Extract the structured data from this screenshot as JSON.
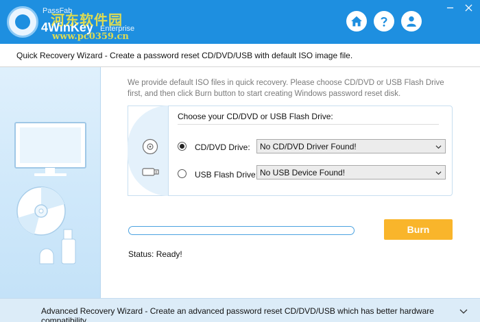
{
  "app": {
    "brand": "PassFab",
    "product": "4WinKey",
    "edition": "Enterprise",
    "watermark": "河东软件园",
    "watermark_url": "www.pc0359.cn"
  },
  "titlebar": {
    "home_icon": "home-icon",
    "help_icon": "help-icon",
    "account_icon": "user-icon",
    "minimize_icon": "minimize-icon",
    "close_icon": "close-icon"
  },
  "wizard": {
    "header": "Quick Recovery Wizard - Create a password reset CD/DVD/USB with default ISO image file.",
    "description": "We provide default ISO files in quick recovery. Please choose CD/DVD or USB Flash Drive first, and then click Burn button to start creating Windows password reset disk.",
    "choose_title": "Choose your CD/DVD or USB Flash Drive:",
    "cd_label": "CD/DVD Drive:",
    "cd_value": "No CD/DVD Driver Found!",
    "cd_selected": true,
    "usb_label": "USB Flash Drive:",
    "usb_value": "No USB Device Found!",
    "usb_selected": false,
    "progress": 0,
    "burn_label": "Burn",
    "status": "Status: Ready!"
  },
  "advanced": {
    "label": "Advanced Recovery Wizard - Create an advanced password reset CD/DVD/USB which has better hardware compatibility.",
    "expand_icon": "chevron-down-icon"
  },
  "colors": {
    "titlebar": "#1e8fe0",
    "burn": "#f9b52b",
    "accent": "#4aa1e0"
  }
}
